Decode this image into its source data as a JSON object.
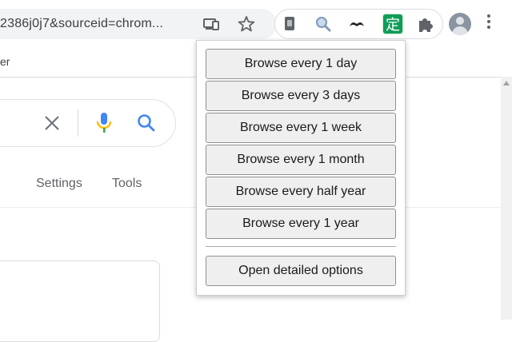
{
  "browser": {
    "url_text": "2386j0j7&sourceid=chrom...",
    "bookmark_text": "er",
    "extensions": [
      "dark-extension-icon",
      "search-extension-icon",
      "mustache-extension-icon",
      "kanji-extension-icon"
    ],
    "active_extension_label": "定",
    "accent_color": "#34a853"
  },
  "page": {
    "tabs": [
      {
        "label": "Settings"
      },
      {
        "label": "Tools"
      }
    ]
  },
  "popup": {
    "buttons": [
      {
        "label": "Browse every 1 day"
      },
      {
        "label": "Browse every 3 days"
      },
      {
        "label": "Browse every 1 week"
      },
      {
        "label": "Browse every 1 month"
      },
      {
        "label": "Browse every half year"
      },
      {
        "label": "Browse every 1 year"
      }
    ],
    "options_label": "Open detailed options"
  }
}
